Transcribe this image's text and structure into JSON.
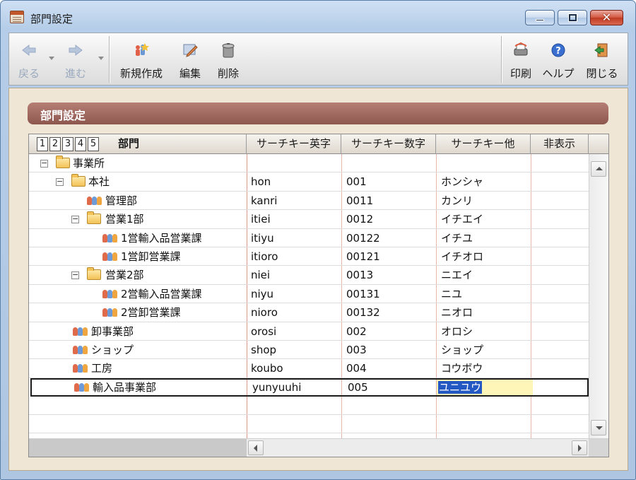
{
  "window": {
    "title": "部門設定"
  },
  "toolbar": {
    "back_label": "戻る",
    "forward_label": "進む",
    "new_label": "新規作成",
    "edit_label": "編集",
    "delete_label": "削除",
    "print_label": "印刷",
    "help_label": "ヘルプ",
    "close_label": "閉じる"
  },
  "section": {
    "title": "部門設定"
  },
  "grid": {
    "levels": [
      "1",
      "2",
      "3",
      "4",
      "5"
    ],
    "columns": {
      "dept": "部門",
      "search_en": "サーチキー英字",
      "search_num": "サーチキー数字",
      "search_other": "サーチキー他",
      "hidden": "非表示"
    },
    "rows": [
      {
        "name": "事業所",
        "en": "",
        "num": "",
        "other": ""
      },
      {
        "name": "本社",
        "en": "hon",
        "num": "001",
        "other": "ホンシャ"
      },
      {
        "name": "管理部",
        "en": "kanri",
        "num": "0011",
        "other": "カンリ"
      },
      {
        "name": "営業1部",
        "en": "itiei",
        "num": "0012",
        "other": "イチエイ"
      },
      {
        "name": "1営輸入品営業課",
        "en": "itiyu",
        "num": "00122",
        "other": "イチユ"
      },
      {
        "name": "1営卸営業課",
        "en": "itioro",
        "num": "00121",
        "other": "イチオロ"
      },
      {
        "name": "営業2部",
        "en": "niei",
        "num": "0013",
        "other": "ニエイ"
      },
      {
        "name": "2営輸入品営業課",
        "en": "niyu",
        "num": "00131",
        "other": "ニユ"
      },
      {
        "name": "2営卸営業課",
        "en": "nioro",
        "num": "00132",
        "other": "ニオロ"
      },
      {
        "name": "卸事業部",
        "en": "orosi",
        "num": "002",
        "other": "オロシ"
      },
      {
        "name": "ショップ",
        "en": "shop",
        "num": "003",
        "other": "ショップ"
      },
      {
        "name": "工房",
        "en": "koubo",
        "num": "004",
        "other": "コウボウ"
      },
      {
        "name": "輸入品事業部",
        "en": "yunyuuhi",
        "num": "005",
        "other": "ユニユウ"
      }
    ]
  }
}
